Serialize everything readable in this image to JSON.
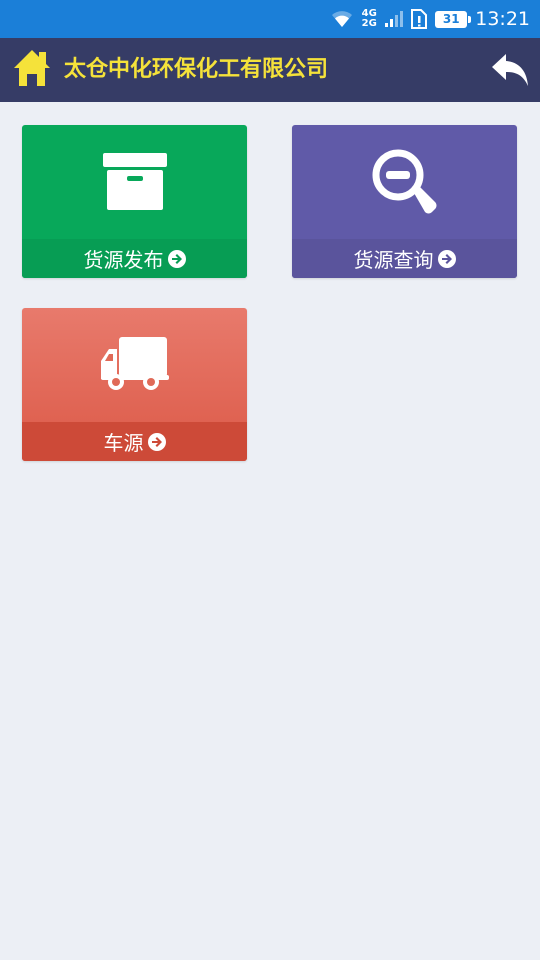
{
  "status_bar": {
    "network_top": "4G",
    "network_bottom": "2G",
    "battery_level": "31",
    "time": "13:21"
  },
  "app_bar": {
    "title": "太仓中化环保化工有限公司",
    "title_color": "#f5e23a",
    "background": "#363c66"
  },
  "tiles": [
    {
      "label": "货源发布",
      "icon": "archive-box-icon",
      "color": "#08a85a"
    },
    {
      "label": "货源查询",
      "icon": "search-minus-icon",
      "color": "#605aa8"
    },
    {
      "label": "车源",
      "icon": "truck-icon",
      "color": "#dc5a48"
    }
  ]
}
